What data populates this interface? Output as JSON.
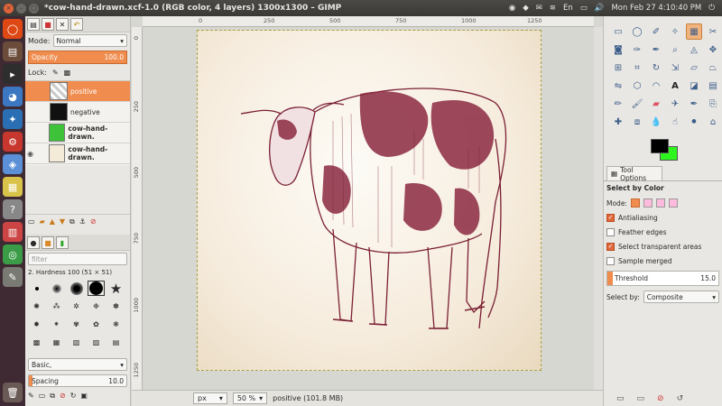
{
  "window": {
    "title": "*cow-hand-drawn.xcf-1.0 (RGB color, 4 layers) 1300x1300 – GIMP"
  },
  "tray": {
    "lang": "En",
    "volume": "🔊",
    "datetime": "Mon Feb 27  4:10:40 PM"
  },
  "layers_panel": {
    "mode_label": "Mode:",
    "mode_value": "Normal",
    "opacity_label": "Opacity",
    "opacity_value": "100.0",
    "lock_label": "Lock:",
    "layers": [
      {
        "name": "positive",
        "selected": true,
        "visible": false
      },
      {
        "name": "negative",
        "selected": false,
        "visible": false
      },
      {
        "name": "cow-hand-drawn.",
        "selected": false,
        "visible": false
      },
      {
        "name": "cow-hand-drawn.",
        "selected": false,
        "visible": true
      }
    ]
  },
  "brushes_panel": {
    "filter_placeholder": "filter",
    "brush_name": "2. Hardness 100 (51 × 51)",
    "preset": "Basic,",
    "spacing_label": "Spacing",
    "spacing_value": "10.0"
  },
  "rulers": {
    "h": [
      "0",
      "250",
      "500",
      "750",
      "1000",
      "1250"
    ],
    "v": [
      "0",
      "250",
      "500",
      "750",
      "1000",
      "1250"
    ]
  },
  "status": {
    "unit": "px",
    "zoom": "50 %",
    "layer_info": "positive (101.8 MB)"
  },
  "tool_options": {
    "tab_label": "Tool Options",
    "tool_name": "Select by Color",
    "mode_label": "Mode:",
    "antialiasing": "Antialiasing",
    "feather": "Feather edges",
    "transparent": "Select transparent areas",
    "sample_merged": "Sample merged",
    "threshold_label": "Threshold",
    "threshold_value": "15.0",
    "select_by_label": "Select by:",
    "select_by_value": "Composite"
  },
  "colors": {
    "foreground": "#000000",
    "background": "#2ff51f",
    "accent": "#ef8c4e"
  }
}
